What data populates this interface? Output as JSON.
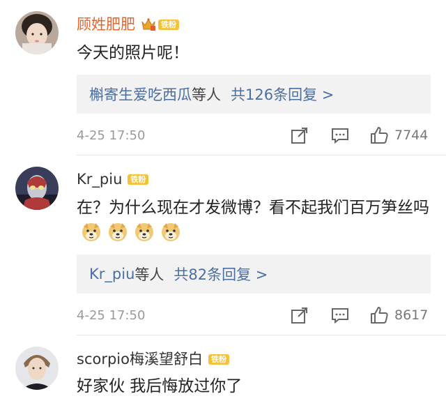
{
  "comments": [
    {
      "username": "顾姓肥肥",
      "badge": "铁粉",
      "text": "今天的照片呢！",
      "reply_names": "槲寄生爱吃西瓜",
      "reply_suffix": "等人",
      "reply_count": "共126条回复 >",
      "timestamp": "4-25 17:50",
      "likes": "7744",
      "icons": [
        "share-icon",
        "comment-icon",
        "like-icon",
        "crown-icon"
      ]
    },
    {
      "username": "Kr_piu",
      "badge": "铁粉",
      "text": "在？为什么现在才发微博？看不起我们百万笋丝吗",
      "emoji_count": 4,
      "reply_names": "Kr_piu",
      "reply_suffix": "等人",
      "reply_count": "共82条回复 >",
      "timestamp": "4-25 17:50",
      "likes": "8617",
      "icons": [
        "share-icon",
        "comment-icon",
        "like-icon",
        "doge-emoji-icon"
      ]
    },
    {
      "username": "scorpio梅溪望舒白",
      "badge": "铁粉",
      "text": "好家伙 我后悔放过你了"
    }
  ],
  "colors": {
    "vip_name": "#e8642b",
    "link": "#4a6fa5",
    "badge": "#f3c23a",
    "reply_bg": "#f2f2f2"
  }
}
